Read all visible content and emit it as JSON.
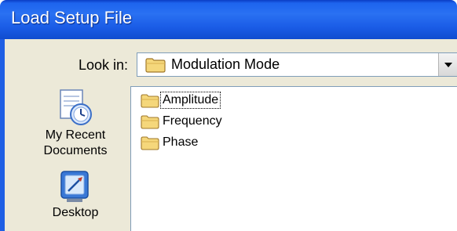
{
  "window": {
    "title": "Load Setup File"
  },
  "lookin": {
    "label": "Look in:",
    "value": "Modulation Mode"
  },
  "places": [
    {
      "label_line1": "My Recent",
      "label_line2": "Documents",
      "icon": "recent-documents-icon"
    },
    {
      "label_line1": "Desktop",
      "label_line2": "",
      "icon": "desktop-icon"
    }
  ],
  "files": [
    {
      "name": "Amplitude",
      "icon": "folder-icon",
      "focused": true
    },
    {
      "name": "Frequency",
      "icon": "folder-icon",
      "focused": false
    },
    {
      "name": "Phase",
      "icon": "folder-icon",
      "focused": false
    }
  ],
  "colors": {
    "titlebar": "#1d64ee",
    "dialog_face": "#ece9d8",
    "border": "#7f9db9",
    "folder": "#f5d77b"
  }
}
